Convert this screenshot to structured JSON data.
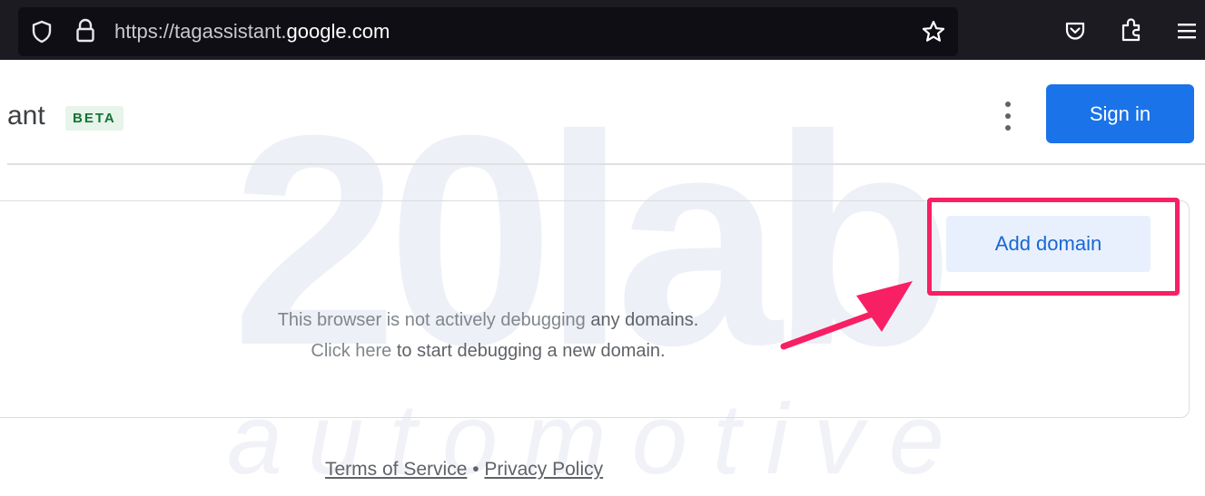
{
  "browser": {
    "url_prefix": "https://tagassistant.",
    "url_host": "google.com",
    "icons": [
      "shield-icon",
      "lock-icon",
      "star-icon",
      "pocket-icon",
      "extensions-icon",
      "menu-icon"
    ]
  },
  "header": {
    "app_title": "ant",
    "beta_label": "BETA",
    "signin_label": "Sign in",
    "more_icon": "more-vert-icon"
  },
  "watermark": {
    "line1": "20lab",
    "line2": "automotive"
  },
  "card": {
    "add_domain_label": "Add domain",
    "message_line1_part1": "This browser is not actively debugging",
    "message_line1_part2": "any domains.",
    "message_line2_part1": "Click here",
    "message_line2_part2": "to start debugging a new domain."
  },
  "annotation": {
    "color": "#f72064"
  },
  "footer": {
    "terms_label": "Terms of Service",
    "separator": "•",
    "privacy_label": "Privacy Policy"
  },
  "colors": {
    "primary": "#1a73e8",
    "beta_bg": "#e6f4ea",
    "beta_text": "#137333"
  }
}
